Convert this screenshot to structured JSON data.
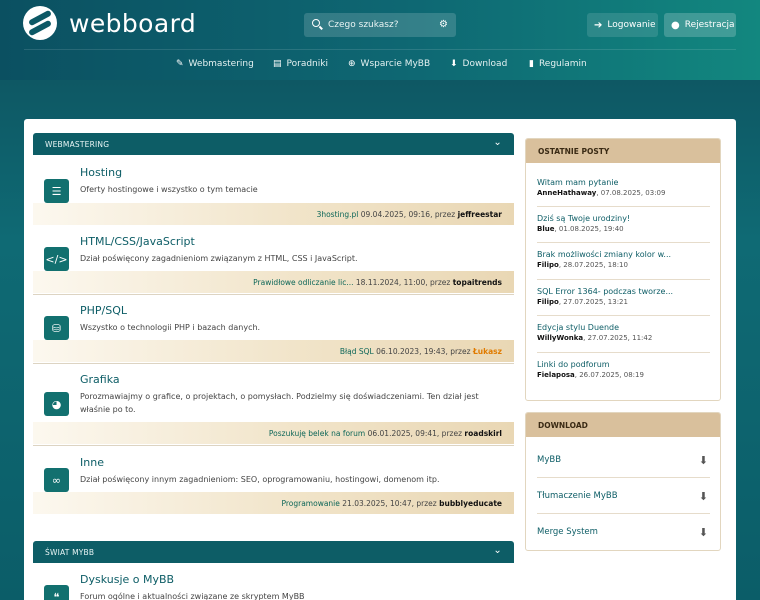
{
  "header": {
    "logo_text": "webboard",
    "search_placeholder": "Czego szukasz?",
    "login_label": "Logowanie",
    "register_label": "Rejestracja"
  },
  "nav": [
    {
      "label": "Webmastering",
      "icon": "wrench-icon"
    },
    {
      "label": "Poradniki",
      "icon": "document-icon"
    },
    {
      "label": "Wsparcie MyBB",
      "icon": "lifebuoy-icon"
    },
    {
      "label": "Download",
      "icon": "download-icon"
    },
    {
      "label": "Regulamin",
      "icon": "bookmark-icon"
    }
  ],
  "categories": [
    {
      "title": "WEBMASTERING",
      "forums": [
        {
          "title": "Hosting",
          "desc": "Oferty hostingowe i wszystko o tym temacie",
          "icon": "server-icon",
          "last_topic": "3hosting.pl",
          "last_meta": "09.04.2025, 09:16, przez",
          "last_user": "jeffreestar"
        },
        {
          "title": "HTML/CSS/JavaScript",
          "desc": "Dział poświęcony zagadnieniom związanym z HTML, CSS i JavaScript.",
          "icon": "code-icon",
          "last_topic": "Prawidłowe odliczanie lic...",
          "last_meta": "18.11.2024, 11:00, przez",
          "last_user": "topaitrends"
        },
        {
          "title": "PHP/SQL",
          "desc": "Wszystko o technologii PHP i bazach danych.",
          "icon": "database-icon",
          "last_topic": "Błąd SQL",
          "last_meta": "06.10.2023, 19:43, przez",
          "last_user": "Łukasz"
        },
        {
          "title": "Grafika",
          "desc": "Porozmawiajmy o grafice, o projektach, o pomysłach. Podzielmy się doświadczeniami. Ten dział jest właśnie po to.",
          "icon": "palette-icon",
          "last_topic": "Poszukuję belek na forum",
          "last_meta": "06.01.2025, 09:41, przez",
          "last_user": "roadskirl"
        },
        {
          "title": "Inne",
          "desc": "Dział poświęcony innym zagadnieniom: SEO, oprogramowaniu, hostingowi, domenom itp.",
          "icon": "infinity-icon",
          "last_topic": "Programowanie",
          "last_meta": "21.03.2025, 10:47, przez",
          "last_user": "bubblyeducate"
        }
      ]
    },
    {
      "title": "ŚWIAT MYBB",
      "forums": [
        {
          "title": "Dyskusje o MyBB",
          "desc": "Forum ogólne i aktualności związane ze skryptem MyBB",
          "icon": "chat-icon"
        }
      ]
    }
  ],
  "sidebar": {
    "latest_title": "OSTATNIE POSTY",
    "posts": [
      {
        "title": "Witam mam pytanie",
        "user": "AnneHathaway",
        "date": "07.08.2025, 03:09"
      },
      {
        "title": "Dziś są Twoje urodziny!",
        "user": "Blue",
        "date": "01.08.2025, 19:40"
      },
      {
        "title": "Brak możliwości zmiany kolor w...",
        "user": "Filipo",
        "date": "28.07.2025, 18:10"
      },
      {
        "title": "SQL Error 1364- podczas tworze...",
        "user": "Filipo",
        "date": "27.07.2025, 13:21"
      },
      {
        "title": "Edycja stylu Duende",
        "user": "WillyWonka",
        "date": "27.07.2025, 11:42"
      },
      {
        "title": "Linki do podforum",
        "user": "Fielaposa",
        "date": "26.07.2025, 08:19"
      }
    ],
    "download_title": "DOWNLOAD",
    "downloads": [
      {
        "label": "MyBB"
      },
      {
        "label": "Tłumaczenie MyBB"
      },
      {
        "label": "Merge System"
      }
    ]
  },
  "colors": {
    "accent": "#0d5d66",
    "side_head": "#d9c09c",
    "highlight_user": "#e07b00"
  }
}
